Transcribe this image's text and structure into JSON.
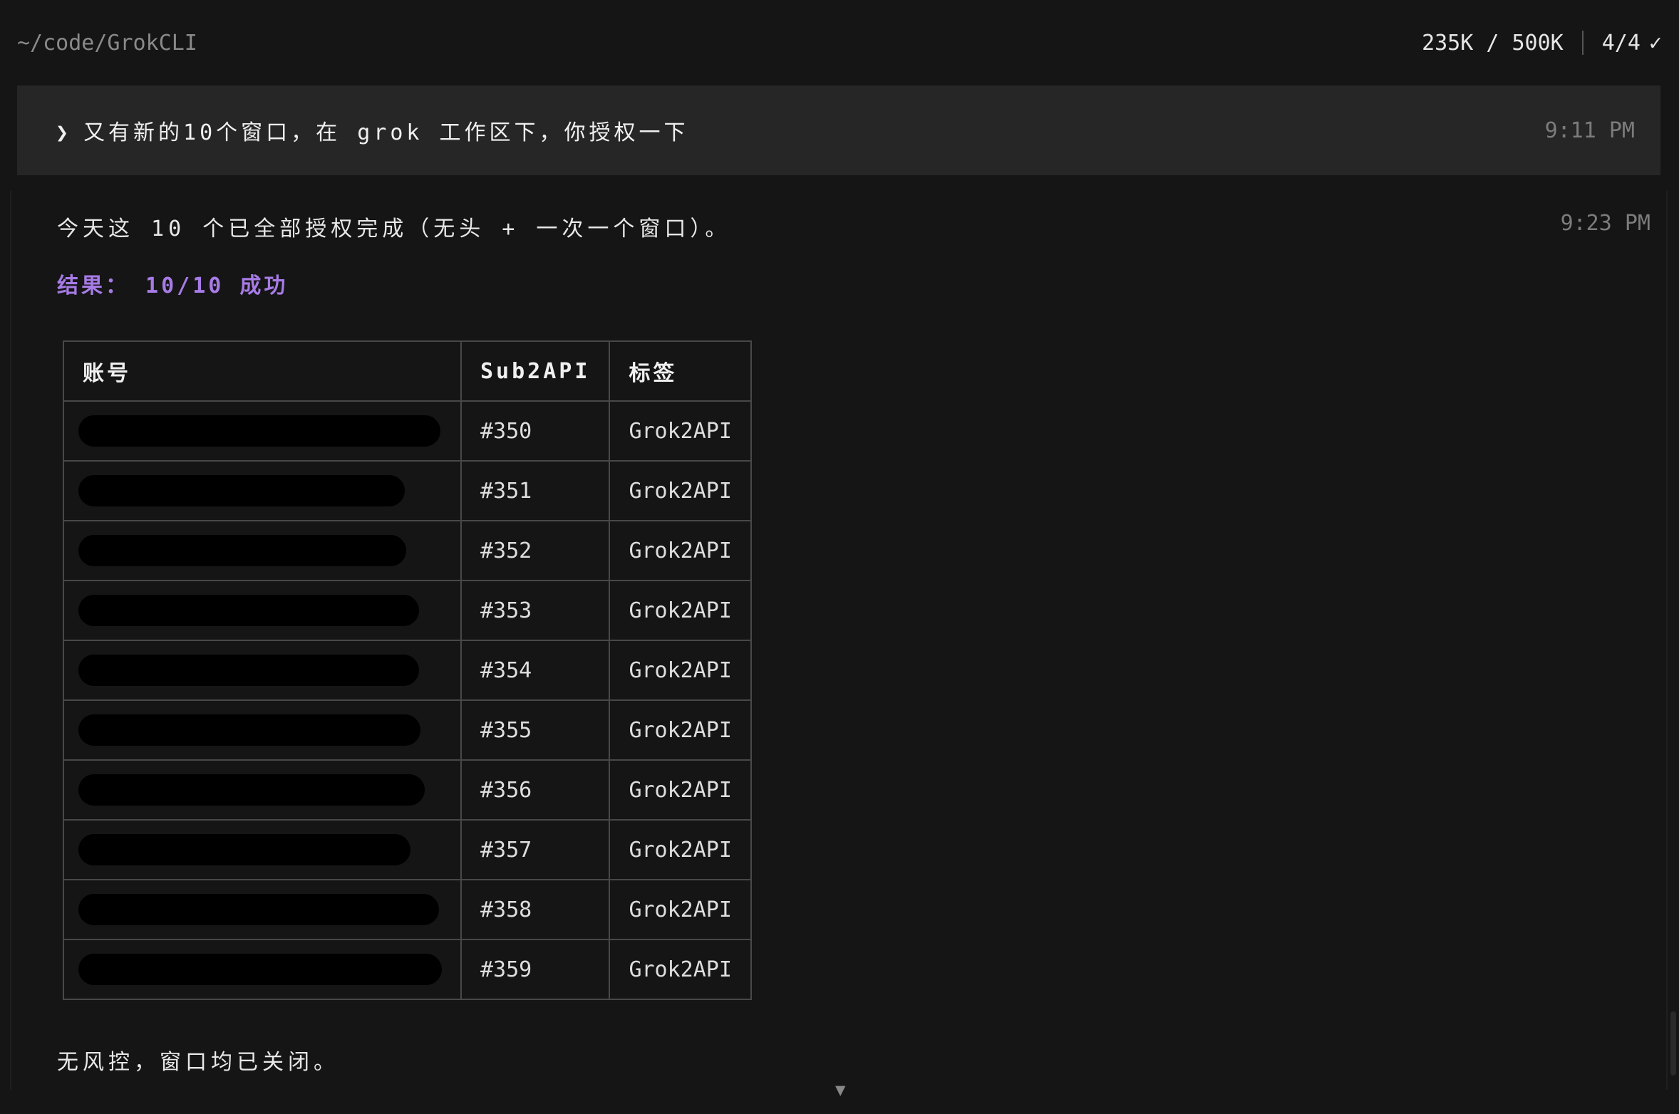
{
  "header": {
    "path": "~/code/GrokCLI",
    "tokens": "235K / 500K",
    "progress": "4/4",
    "check_icon": "✓"
  },
  "user_message": {
    "caret": "❯",
    "text": "又有新的10个窗口，在 grok 工作区下，你授权一下",
    "time": "9:11 PM"
  },
  "assistant_message": {
    "time": "9:23 PM",
    "summary": "今天这 10 个已全部授权完成（无头 + 一次一个窗口）。",
    "result": "结果： 10/10 成功",
    "footer": "无风控，窗口均已关闭。"
  },
  "table": {
    "headers": [
      "账号",
      "Sub2API",
      "标签"
    ],
    "rows": [
      {
        "account": "[redacted]",
        "sub2api": "#350",
        "tag": "Grok2API"
      },
      {
        "account": "[redacted]",
        "sub2api": "#351",
        "tag": "Grok2API"
      },
      {
        "account": "[redacted]",
        "sub2api": "#352",
        "tag": "Grok2API"
      },
      {
        "account": "[redacted]",
        "sub2api": "#353",
        "tag": "Grok2API"
      },
      {
        "account": "[redacted]",
        "sub2api": "#354",
        "tag": "Grok2API"
      },
      {
        "account": "[redacted]",
        "sub2api": "#355",
        "tag": "Grok2API"
      },
      {
        "account": "[redacted]",
        "sub2api": "#356",
        "tag": "Grok2API"
      },
      {
        "account": "[redacted]",
        "sub2api": "#357",
        "tag": "Grok2API"
      },
      {
        "account": "[redacted]",
        "sub2api": "#358",
        "tag": "Grok2API"
      },
      {
        "account": "[redacted]",
        "sub2api": "#359",
        "tag": "Grok2API"
      }
    ]
  },
  "scroll_down_icon": "▼",
  "colors": {
    "background": "#151515",
    "user_bubble": "#262626",
    "result_accent": "#a77be6"
  }
}
